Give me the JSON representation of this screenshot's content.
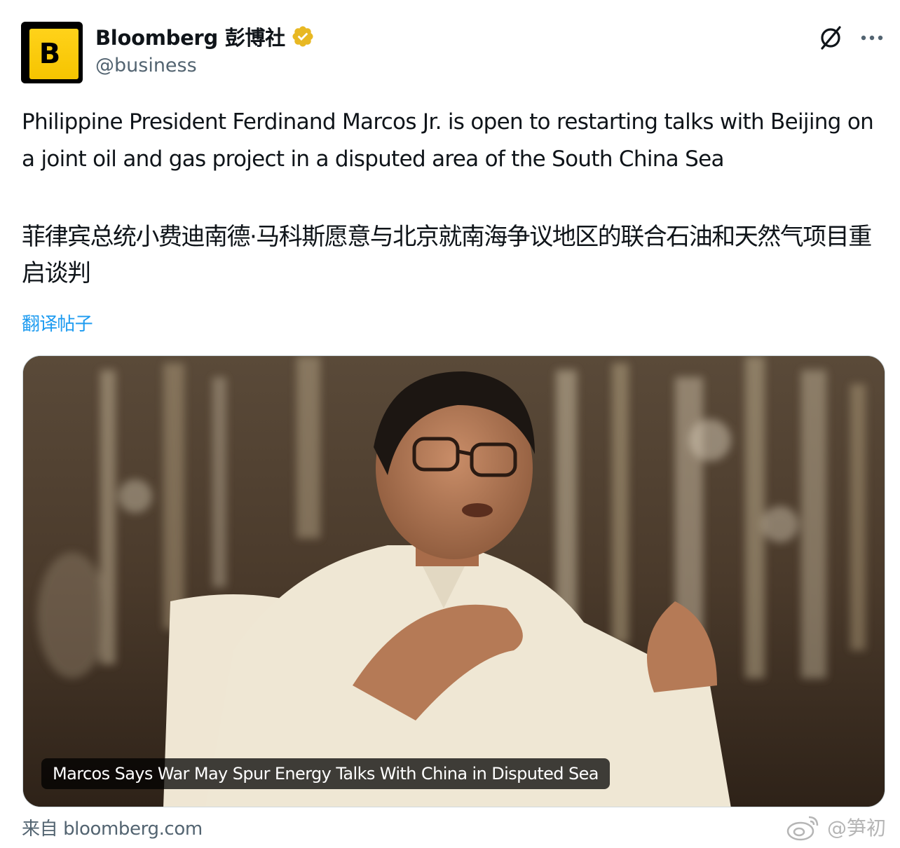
{
  "author": {
    "display_name": "Bloomberg 彭博社",
    "handle": "@business",
    "avatar_letter": "B",
    "verified_icon": "verified-badge-gold",
    "brand_color": "#f8c800"
  },
  "actions": {
    "grok_icon": "grok-icon",
    "more_icon": "more-options-icon"
  },
  "tweet": {
    "text": "Philippine President Ferdinand Marcos Jr. is open to restarting talks with Beijing on a joint oil and gas project in a disputed area of the South China Sea",
    "text_zh": "菲律宾总统小费迪南德·马科斯愿意与北京就南海争议地区的联合石油和天然气项目重启谈判",
    "translate_label": "翻译帖子"
  },
  "card": {
    "headline": "Marcos Says War May Spur Energy Talks With China in Disputed Sea",
    "source": "来自 bloomberg.com"
  },
  "watermark": {
    "text": "@笋初",
    "icon": "weibo-icon"
  },
  "colors": {
    "link": "#1d9bf0",
    "secondary": "#536471",
    "text": "#0f1419",
    "verified": "#e8b823"
  }
}
